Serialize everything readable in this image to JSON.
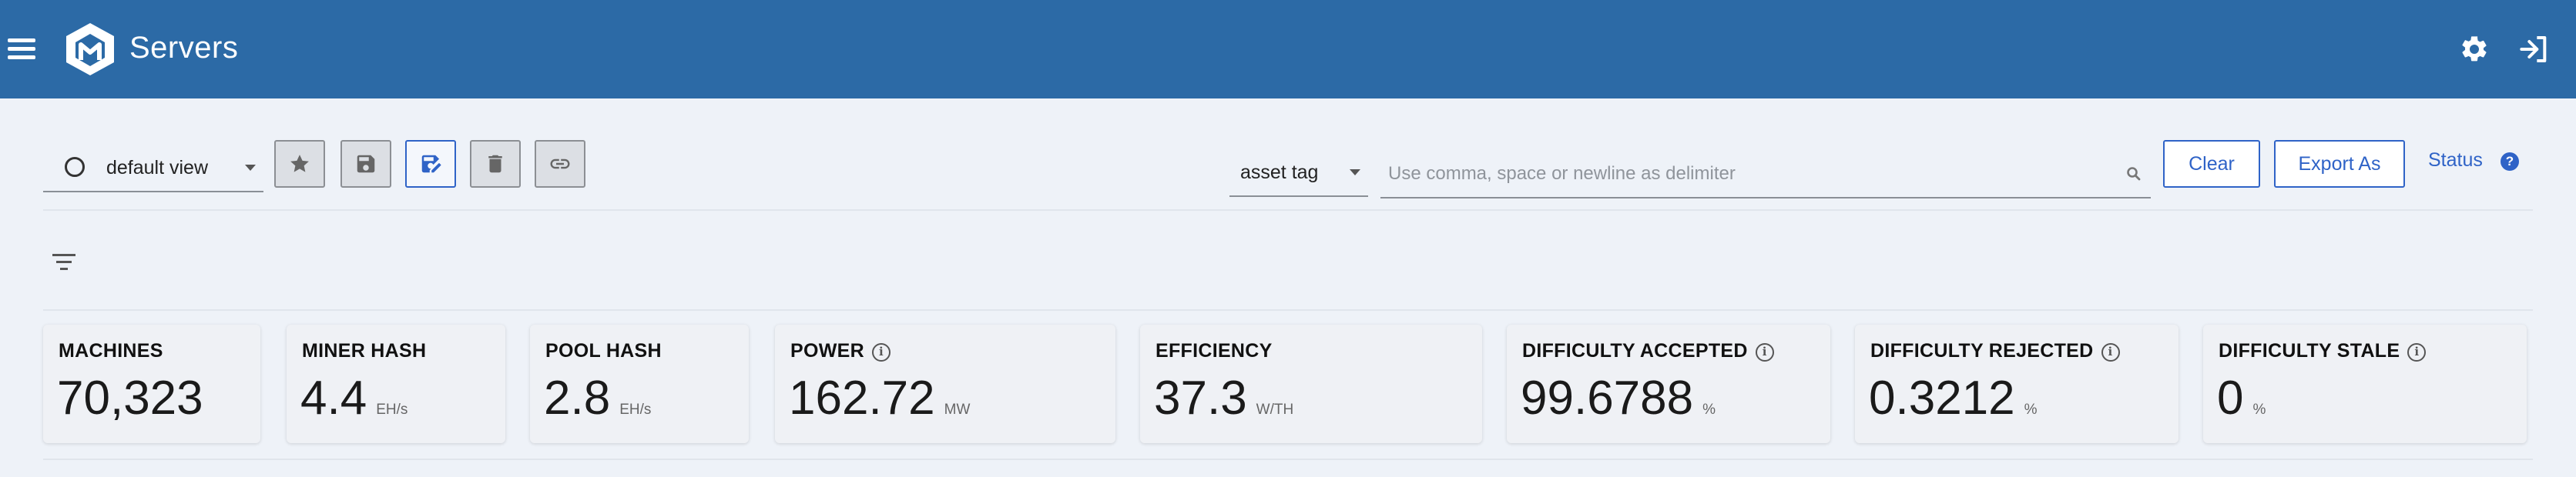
{
  "header": {
    "title": "Servers",
    "menu_icon": "hamburger-menu-icon",
    "logo_icon": "cube-logo-icon",
    "settings_icon": "gear-icon",
    "logout_icon": "logout-icon",
    "background_color": "#2c6aa6"
  },
  "toolbar": {
    "view": {
      "selected": "default view"
    },
    "buttons": [
      {
        "icon": "star-icon"
      },
      {
        "icon": "save-icon"
      },
      {
        "icon": "save-edit-icon",
        "active": true
      },
      {
        "icon": "trash-icon"
      },
      {
        "icon": "link-icon"
      }
    ],
    "search_field": {
      "selected": "asset tag"
    },
    "search": {
      "value": "",
      "placeholder": "Use comma, space or newline as delimiter"
    },
    "clear_label": "Clear",
    "export_label": "Export As",
    "status_label": "Status",
    "accent_color": "#2f63c7"
  },
  "metrics": [
    {
      "label": "MACHINES",
      "value": "70,323",
      "unit": "",
      "info": false
    },
    {
      "label": "MINER HASH",
      "value": "4.4",
      "unit": "EH/s",
      "info": false
    },
    {
      "label": "POOL HASH",
      "value": "2.8",
      "unit": "EH/s",
      "info": false
    },
    {
      "label": "POWER",
      "value": "162.72",
      "unit": "MW",
      "info": true
    },
    {
      "label": "EFFICIENCY",
      "value": "37.3",
      "unit": "W/TH",
      "info": false
    },
    {
      "label": "DIFFICULTY ACCEPTED",
      "value": "99.6788",
      "unit": "%",
      "info": true
    },
    {
      "label": "DIFFICULTY REJECTED",
      "value": "0.3212",
      "unit": "%",
      "info": true
    },
    {
      "label": "DIFFICULTY STALE",
      "value": "0",
      "unit": "%",
      "info": true
    }
  ]
}
